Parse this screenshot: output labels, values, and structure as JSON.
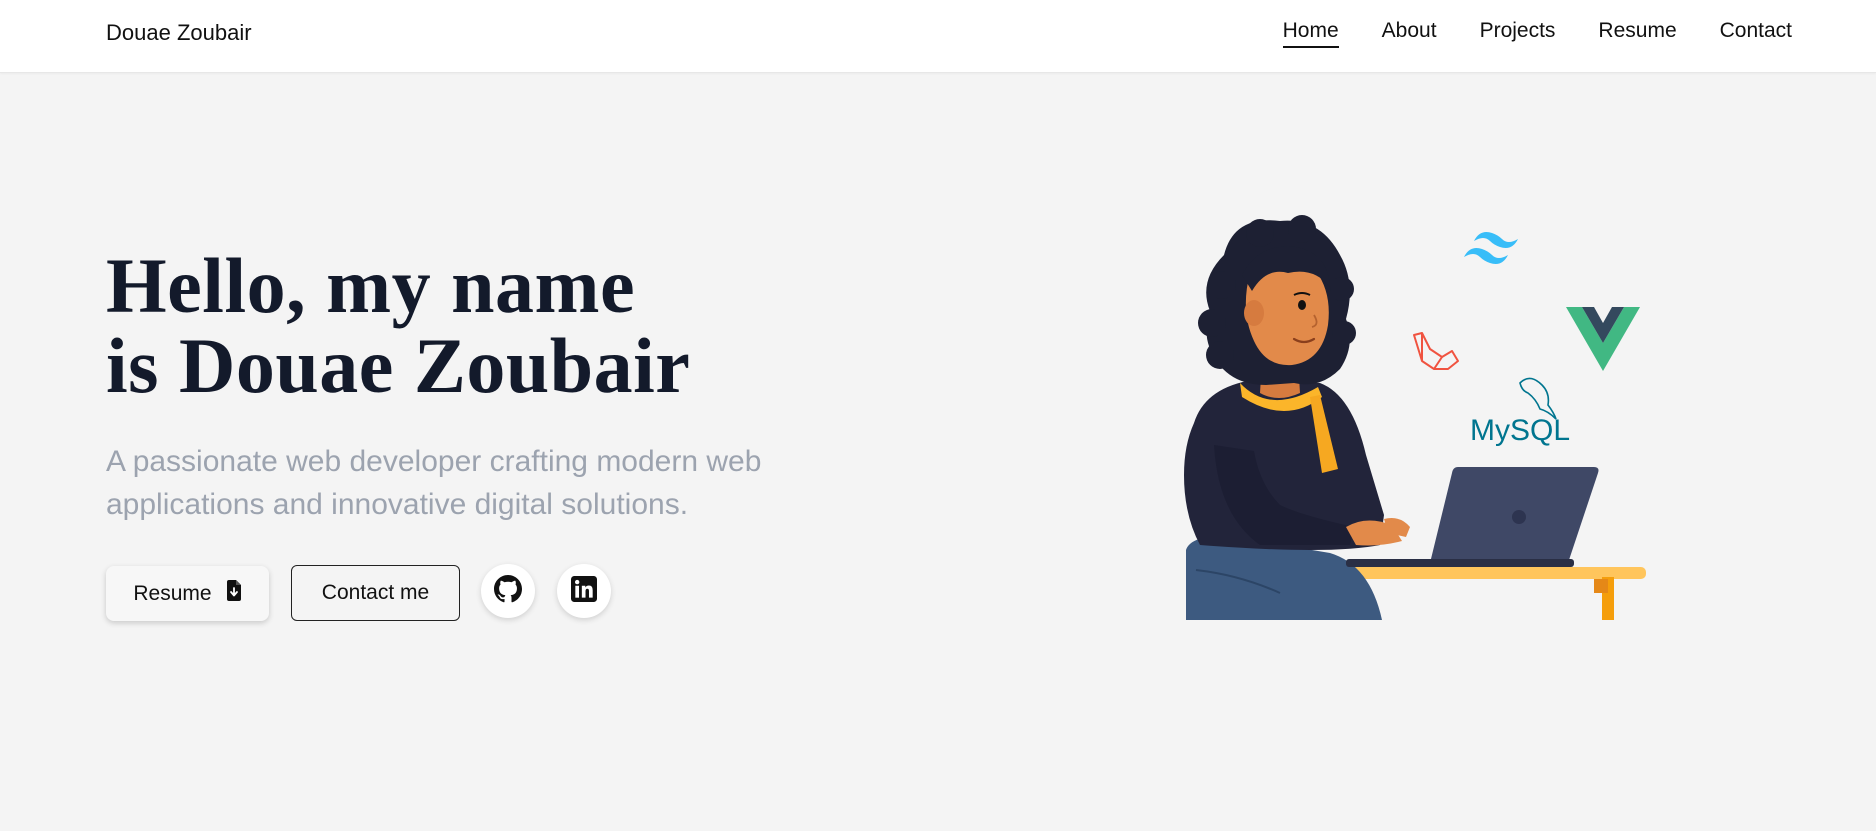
{
  "header": {
    "brand": "Douae Zoubair",
    "nav": [
      {
        "label": "Home",
        "active": true
      },
      {
        "label": "About",
        "active": false
      },
      {
        "label": "Projects",
        "active": false
      },
      {
        "label": "Resume",
        "active": false
      },
      {
        "label": "Contact",
        "active": false
      }
    ]
  },
  "hero": {
    "title_line1": "Hello, my name",
    "title_line2": "is Douae Zoubair",
    "subtitle_line1": "A passionate web developer crafting modern web",
    "subtitle_line2": "applications and innovative digital solutions.",
    "resume_button": "Resume",
    "contact_button": "Contact me",
    "socials": [
      {
        "icon": "github-icon"
      },
      {
        "icon": "linkedin-icon"
      }
    ]
  },
  "illustration": {
    "tech_logos": [
      "tailwind-icon",
      "vue-icon",
      "laravel-icon",
      "mysql-icon"
    ],
    "mysql_label": "MySQL"
  },
  "colors": {
    "background": "#f4f4f4",
    "header_bg": "#ffffff",
    "title": "#131a2b",
    "subtitle": "#9ca3af",
    "tailwind": "#38bdf8",
    "vue_green": "#41b883",
    "vue_dark": "#34495e",
    "laravel": "#f05340",
    "mysql": "#00758f"
  }
}
